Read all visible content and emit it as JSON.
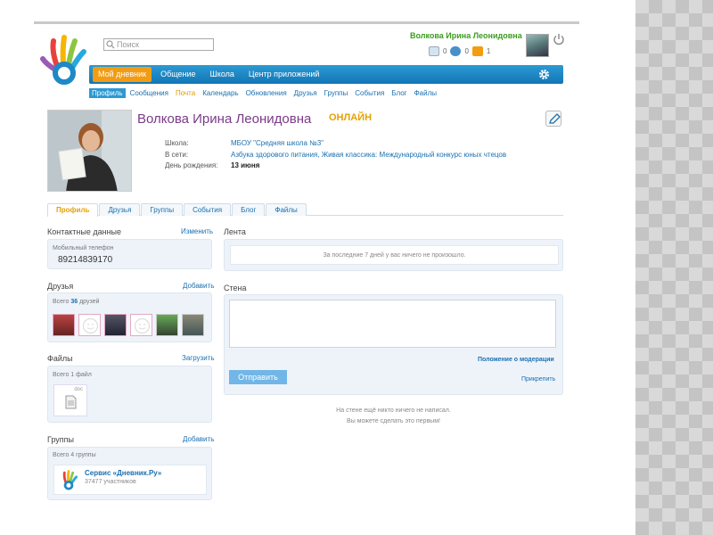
{
  "search": {
    "placeholder": "Поиск"
  },
  "header": {
    "user_name": "Волкова Ирина Леонидовна",
    "counters": [
      "0",
      "0",
      "1"
    ]
  },
  "nav": {
    "items": [
      "Мой дневник",
      "Общение",
      "Школа",
      "Центр приложений"
    ]
  },
  "subnav": {
    "items": [
      "Профиль",
      "Сообщения",
      "Почта",
      "Календарь",
      "Обновления",
      "Друзья",
      "Группы",
      "События",
      "Блог",
      "Файлы"
    ]
  },
  "profile": {
    "name": "Волкова Ирина Леонидовна",
    "status": "ОНЛАЙН",
    "school_label": "Школа:",
    "school_value": "МБОУ \"Средняя школа №3\"",
    "networks_label": "В сети:",
    "networks_value": "Азбука здорового питания, Живая классика: Международный конкурс юных чтецов",
    "birthday_label": "День рождения:",
    "birthday_value": "13 июня"
  },
  "tabs": [
    "Профиль",
    "Друзья",
    "Группы",
    "События",
    "Блог",
    "Файлы"
  ],
  "contacts": {
    "title": "Контактные данные",
    "edit_link": "Изменить",
    "phone_label": "Мобильный телефон",
    "phone_value": "89214839170"
  },
  "friends": {
    "title": "Друзья",
    "add_link": "Добавить",
    "total_prefix": "Всего",
    "total_count": "36",
    "total_suffix": "друзей"
  },
  "files": {
    "title": "Файлы",
    "upload_link": "Загрузить",
    "total": "Всего 1 файл",
    "file_ext": "doc"
  },
  "groups": {
    "title": "Группы",
    "add_link": "Добавить",
    "total": "Всего 4 группы",
    "group_name": "Сервис «Дневник.Ру»",
    "group_members": "37477 участников"
  },
  "feed": {
    "title": "Лента",
    "empty": "За последние 7 дней у вас ничего не произошло."
  },
  "wall": {
    "title": "Стена",
    "moderation_link": "Положение о модерации",
    "send_button": "Отправить",
    "attach_link": "Прикрепить",
    "empty_line1": "На стене ещё никто ничего не написал.",
    "empty_line2": "Вы можете сделать это первым!"
  },
  "colors": {
    "nav_blue": "#1f88c6",
    "nav_active": "#f39c12",
    "name_purple": "#7a3a88",
    "online_orange": "#e6a100",
    "link_blue": "#1a70b0",
    "top_name_green": "#3c9c1e"
  }
}
